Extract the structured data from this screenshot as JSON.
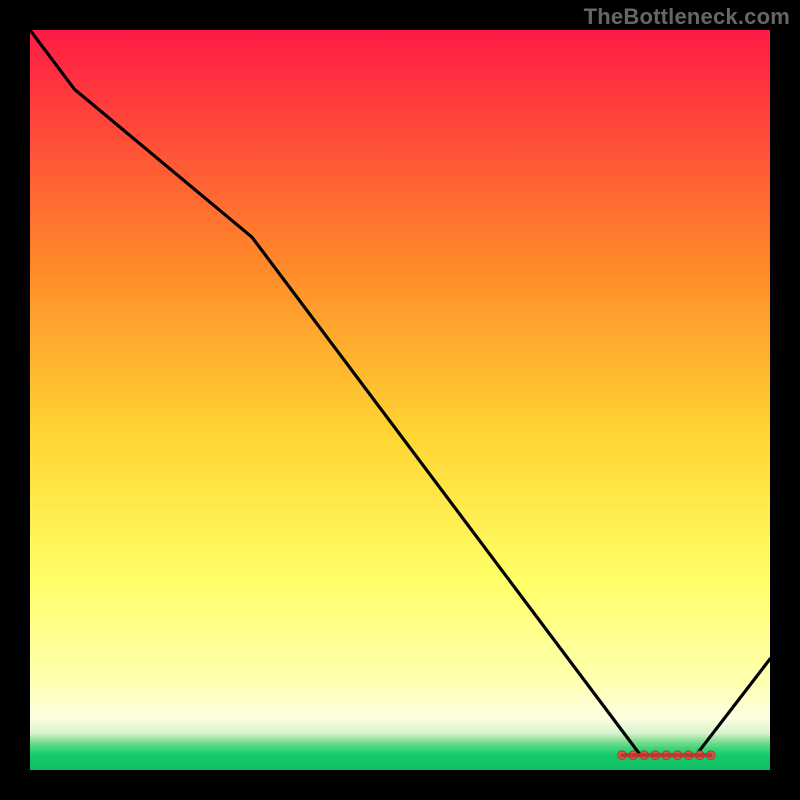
{
  "watermark": "TheBottleneck.com",
  "colors": {
    "page_bg": "#000000",
    "gradient_top": "#ff1a44",
    "gradient_mid_upper": "#ff8a2a",
    "gradient_mid": "#ffd633",
    "gradient_mid_lower": "#ffff66",
    "gradient_pale": "#fdfee0",
    "band_green1": "#8de09a",
    "band_green2": "#3fd77a",
    "band_green3": "#17c96b",
    "band_green4": "#0fbf63",
    "curve_stroke": "#000000",
    "marker_fill": "#e0564a",
    "marker_stroke": "#b33b30"
  },
  "chart_data": {
    "type": "line",
    "title": "",
    "xlabel": "",
    "ylabel": "",
    "xlim": [
      0,
      100
    ],
    "ylim": [
      0,
      100
    ],
    "x": [
      0,
      6,
      30,
      82.5,
      90,
      100
    ],
    "values": [
      100,
      92,
      72,
      2,
      2,
      15
    ],
    "optimal_region_x": [
      80,
      92
    ],
    "optimal_region_y": 2,
    "markers_x": [
      80,
      81.5,
      83,
      84.5,
      86,
      87.5,
      89,
      90.5,
      92
    ],
    "markers_y": 2
  }
}
